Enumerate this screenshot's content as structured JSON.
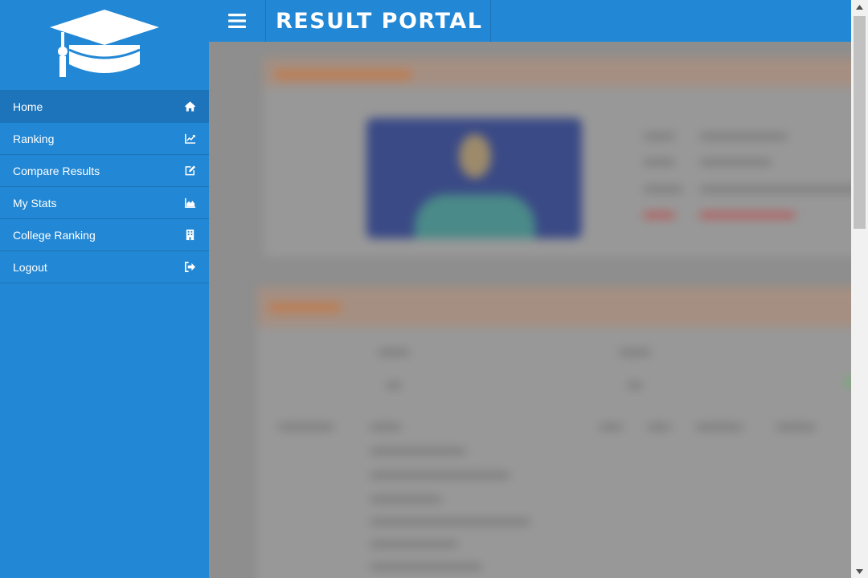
{
  "app": {
    "title": "RESULT PORTAL"
  },
  "sidebar": {
    "logo_icon": "graduation-cap-icon",
    "items": [
      {
        "label": "Home",
        "icon": "home-icon",
        "active": true
      },
      {
        "label": "Ranking",
        "icon": "line-chart-icon"
      },
      {
        "label": "Compare Results",
        "icon": "edit-icon"
      },
      {
        "label": "My Stats",
        "icon": "area-chart-icon"
      },
      {
        "label": "College Ranking",
        "icon": "building-icon"
      },
      {
        "label": "Logout",
        "icon": "sign-out-icon"
      }
    ]
  },
  "header": {
    "menu_icon": "hamburger-menu-icon"
  },
  "content": {
    "state": "blurred"
  },
  "colors": {
    "primary": "#2287d4",
    "active_item": "#1d74bb",
    "overlay": "#8e8e8e"
  }
}
